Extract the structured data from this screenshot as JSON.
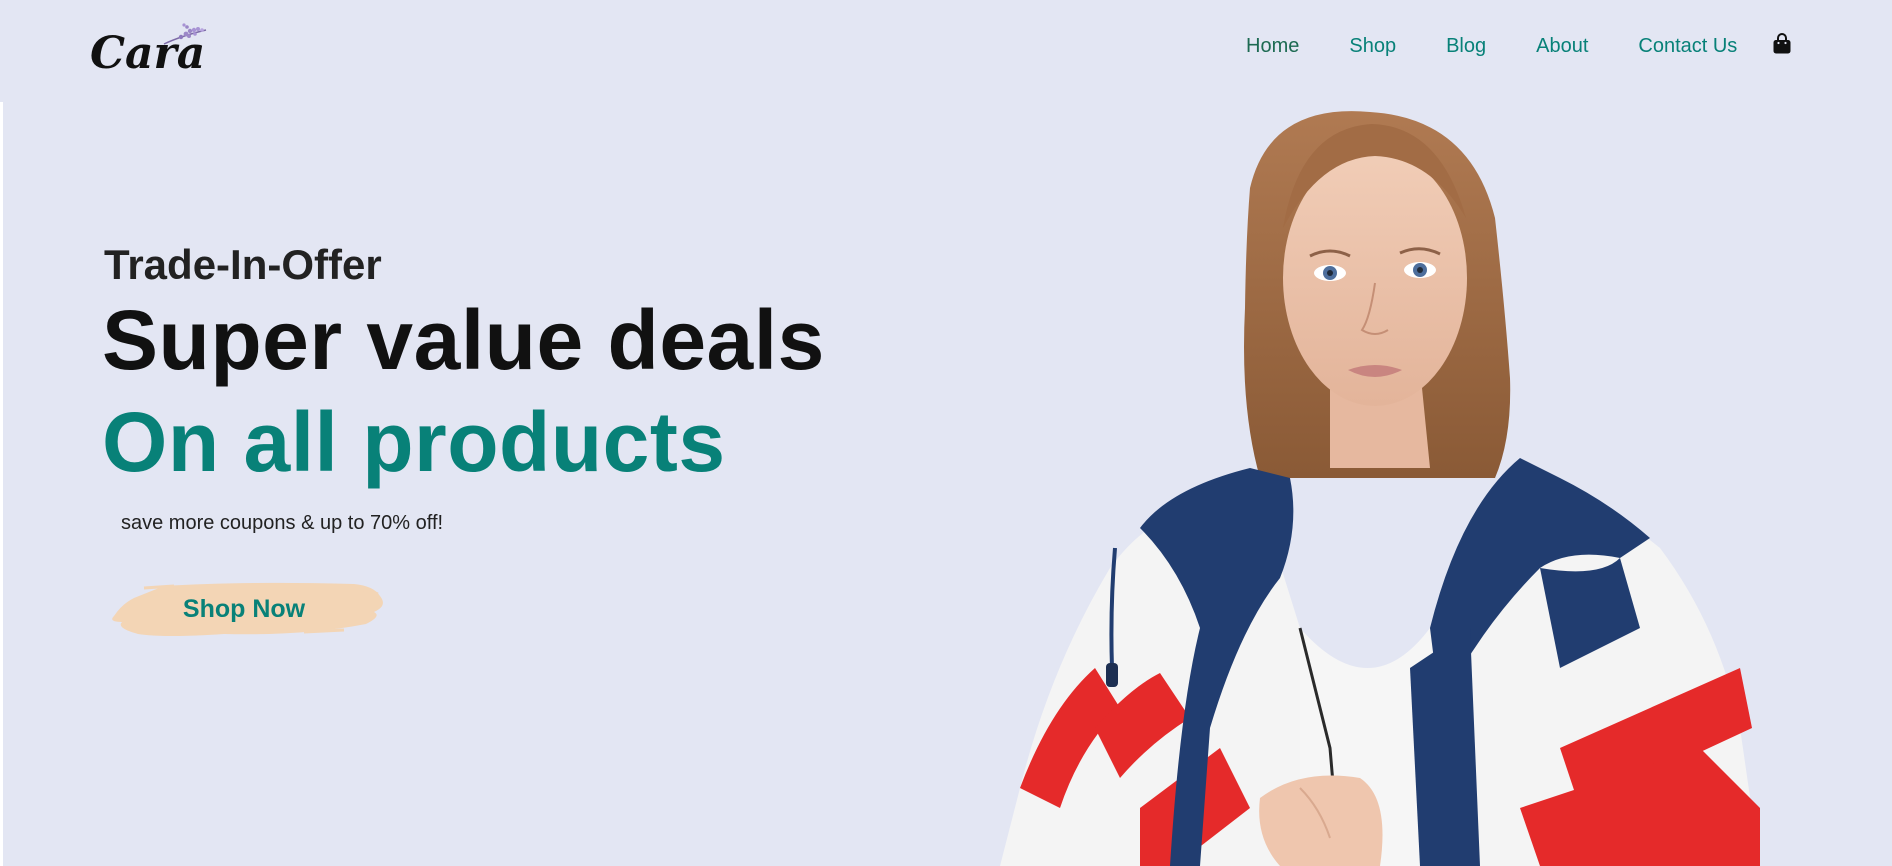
{
  "brand": {
    "logo_text": "Cara"
  },
  "nav": {
    "items": [
      {
        "label": "Home"
      },
      {
        "label": "Shop"
      },
      {
        "label": "Blog"
      },
      {
        "label": "About"
      },
      {
        "label": "Contact Us"
      }
    ],
    "cart_icon": "shopping-bag-icon"
  },
  "hero": {
    "kicker": "Trade-In-Offer",
    "headline": "Super value deals",
    "subheadline": "On all products",
    "description": "save more coupons & up to 70% off!",
    "cta_label": "Shop Now",
    "image": "woman-in-windbreaker-photo"
  },
  "colors": {
    "background": "#e3e6f3",
    "accent": "#088178",
    "cta_brush": "#f3d5b5",
    "text_dark": "#111111"
  }
}
